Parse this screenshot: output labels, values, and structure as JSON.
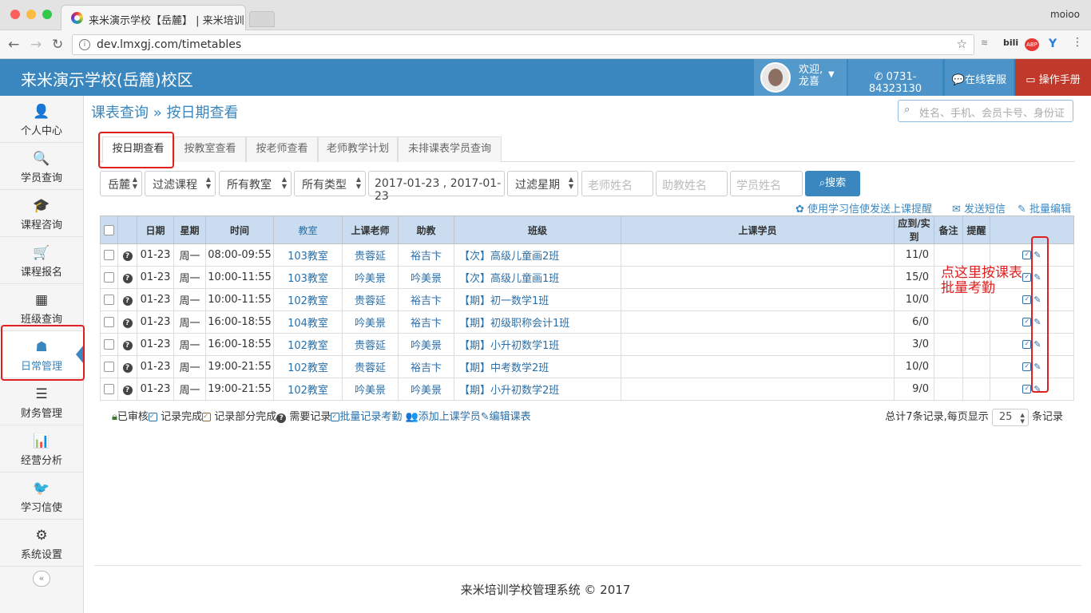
{
  "browser": {
    "tab_title": "来米演示学校【岳麓】 | 来米培训",
    "profile": "moioo",
    "url": "dev.lmxgj.com/timetables"
  },
  "header": {
    "brand": "来米演示学校(岳麓)校区",
    "welcome": "欢迎,",
    "user_name": "龙喜",
    "phone": "0731-84323130",
    "service": "在线客服",
    "manual": "操作手册"
  },
  "sidebar": {
    "items": [
      {
        "label": "个人中心",
        "icon": "user-icon"
      },
      {
        "label": "学员查询",
        "icon": "search-icon"
      },
      {
        "label": "课程咨询",
        "icon": "graduation-cap-icon"
      },
      {
        "label": "课程报名",
        "icon": "cart-icon"
      },
      {
        "label": "班级查询",
        "icon": "cubes-icon"
      },
      {
        "label": "日常管理",
        "icon": "daily-icon"
      },
      {
        "label": "财务管理",
        "icon": "bars-icon"
      },
      {
        "label": "经营分析",
        "icon": "chart-icon"
      },
      {
        "label": "学习信使",
        "icon": "twitter-icon"
      },
      {
        "label": "系统设置",
        "icon": "gears-icon"
      }
    ],
    "collapse": "«"
  },
  "page": {
    "title": "课表查询 » 按日期查看",
    "global_search_placeholder": "姓名、手机、会员卡号、身份证"
  },
  "tabs": [
    "按日期查看",
    "按教室查看",
    "按老师查看",
    "老师教学计划",
    "未排课表学员查询"
  ],
  "filters": {
    "campus": "岳麓",
    "course": "过滤课程",
    "room": "所有教室",
    "type": "所有类型",
    "date_range": "2017-01-23 , 2017-01-23",
    "weekday": "过滤星期",
    "teacher_placeholder": "老师姓名",
    "assistant_placeholder": "助教姓名",
    "student_placeholder": "学员姓名",
    "search_button": "搜索"
  },
  "actions": {
    "wechat_reminder": "使用学习信使发送上课提醒",
    "sms": "发送短信",
    "batch_edit": "批量编辑"
  },
  "table": {
    "headers": [
      "日期",
      "星期",
      "时间",
      "教室",
      "上课老师",
      "助教",
      "班级",
      "上课学员",
      "应到/实到",
      "备注",
      "提醒"
    ],
    "rows": [
      {
        "date": "01-23",
        "weekday": "周一",
        "time": "08:00-09:55",
        "room": "103教室",
        "teacher": "贵蓉延",
        "assistant": "裕吉卞",
        "class": "【次】高级儿童画2班",
        "students": "",
        "attendance": "11/0"
      },
      {
        "date": "01-23",
        "weekday": "周一",
        "time": "10:00-11:55",
        "room": "103教室",
        "teacher": "吟美景",
        "assistant": "吟美景",
        "class": "【次】高级儿童画1班",
        "students": "",
        "attendance": "15/0"
      },
      {
        "date": "01-23",
        "weekday": "周一",
        "time": "10:00-11:55",
        "room": "102教室",
        "teacher": "贵蓉延",
        "assistant": "裕吉卞",
        "class": "【期】初一数学1班",
        "students": "",
        "attendance": "10/0"
      },
      {
        "date": "01-23",
        "weekday": "周一",
        "time": "16:00-18:55",
        "room": "104教室",
        "teacher": "吟美景",
        "assistant": "裕吉卞",
        "class": "【期】初级职称会计1班",
        "students": "",
        "attendance": "6/0"
      },
      {
        "date": "01-23",
        "weekday": "周一",
        "time": "16:00-18:55",
        "room": "102教室",
        "teacher": "贵蓉延",
        "assistant": "吟美景",
        "class": "【期】小升初数学1班",
        "students": "",
        "attendance": "3/0"
      },
      {
        "date": "01-23",
        "weekday": "周一",
        "time": "19:00-21:55",
        "room": "102教室",
        "teacher": "贵蓉延",
        "assistant": "裕吉卞",
        "class": "【期】中考数学2班",
        "students": "",
        "attendance": "10/0"
      },
      {
        "date": "01-23",
        "weekday": "周一",
        "time": "19:00-21:55",
        "room": "102教室",
        "teacher": "吟美景",
        "assistant": "吟美景",
        "class": "【期】小升初数学2班",
        "students": "",
        "attendance": "9/0"
      }
    ]
  },
  "legend": {
    "reviewed": "已审核",
    "done": "记录完成",
    "partial": "记录部分完成",
    "needed": "需要记录",
    "batch_attendance": "批量记录考勤",
    "add_student": "添加上课学员",
    "edit_timetable": "编辑课表"
  },
  "pager": {
    "summary": "总计7条记录,每页显示",
    "per_page": "25",
    "suffix": "条记录"
  },
  "footer": "来米培训学校管理系统 © 2017",
  "annotation": {
    "line1": "点这里按课表",
    "line2": "批量考勤"
  },
  "colors": {
    "header": "#3a86bf",
    "accent": "#2b6fa8",
    "annotation": "#e02020",
    "manual_button": "#c0392b"
  }
}
